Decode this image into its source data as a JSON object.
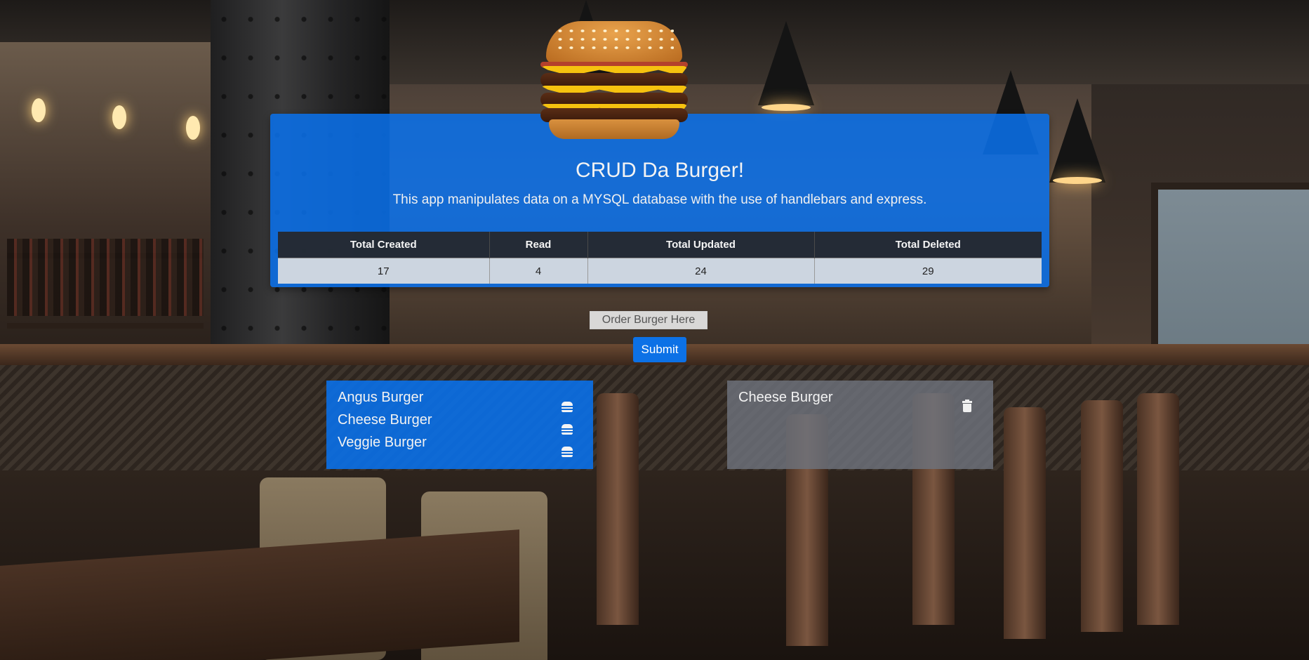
{
  "header": {
    "title": "CRUD Da Burger!",
    "subtitle": "This app manipulates data on a MYSQL database with the use of handlebars and express."
  },
  "stats": {
    "headers": [
      "Total Created",
      "Read",
      "Total Updated",
      "Total Deleted"
    ],
    "values": [
      "17",
      "4",
      "24",
      "29"
    ]
  },
  "order": {
    "placeholder": "Order Burger Here",
    "submit_label": "Submit"
  },
  "menu_list": {
    "items": [
      {
        "name": "Angus Burger",
        "icon": "burger-icon"
      },
      {
        "name": "Cheese Burger",
        "icon": "burger-icon"
      },
      {
        "name": "Veggie Burger",
        "icon": "burger-icon"
      }
    ]
  },
  "devoured_list": {
    "items": [
      {
        "name": "Cheese Burger",
        "icon": "trash-icon"
      }
    ]
  },
  "colors": {
    "accent": "#0a70e8",
    "table_header": "#262628",
    "devoured_panel": "#6e737d"
  }
}
